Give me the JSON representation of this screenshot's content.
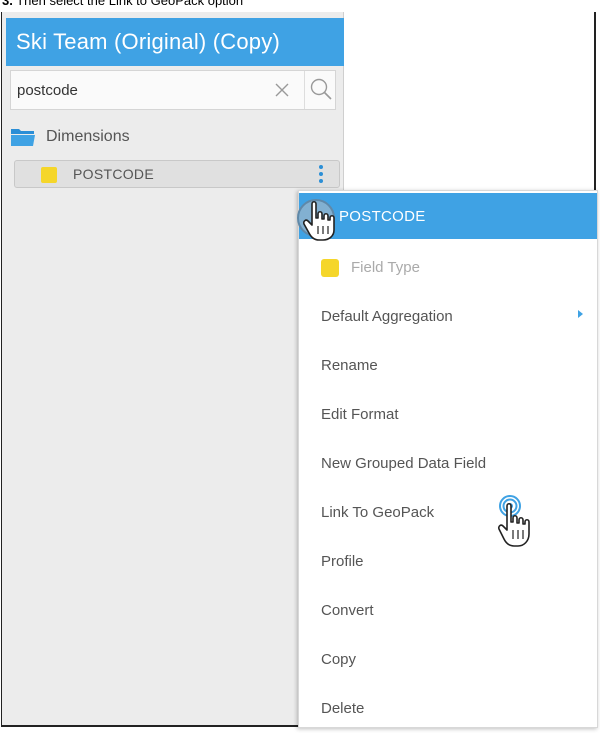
{
  "caption": {
    "step": "3.",
    "text": " Then select the Link to GeoPack option"
  },
  "panel": {
    "title": "Ski Team (Original) (Copy)",
    "search": {
      "value": "postcode",
      "placeholder": ""
    },
    "folder_label": "Dimensions",
    "field": {
      "label": "POSTCODE",
      "swatch_color": "#f5d62a"
    }
  },
  "menu": {
    "header": "POSTCODE",
    "items": [
      {
        "label": "Field Type",
        "disabled": true,
        "has_swatch": true
      },
      {
        "label": "Default Aggregation",
        "has_submenu": true
      },
      {
        "label": "Rename"
      },
      {
        "label": "Edit Format"
      },
      {
        "label": "New Grouped Data Field"
      },
      {
        "label": "Link To GeoPack"
      },
      {
        "label": "Profile"
      },
      {
        "label": "Convert"
      },
      {
        "label": "Copy"
      },
      {
        "label": "Delete"
      }
    ]
  },
  "colors": {
    "accent": "#3fa2e4",
    "field_yellow": "#f5d62a"
  },
  "icons": [
    "clear-icon",
    "search-icon",
    "folder-icon",
    "kebab-menu-icon",
    "hand-cursor-icon"
  ]
}
